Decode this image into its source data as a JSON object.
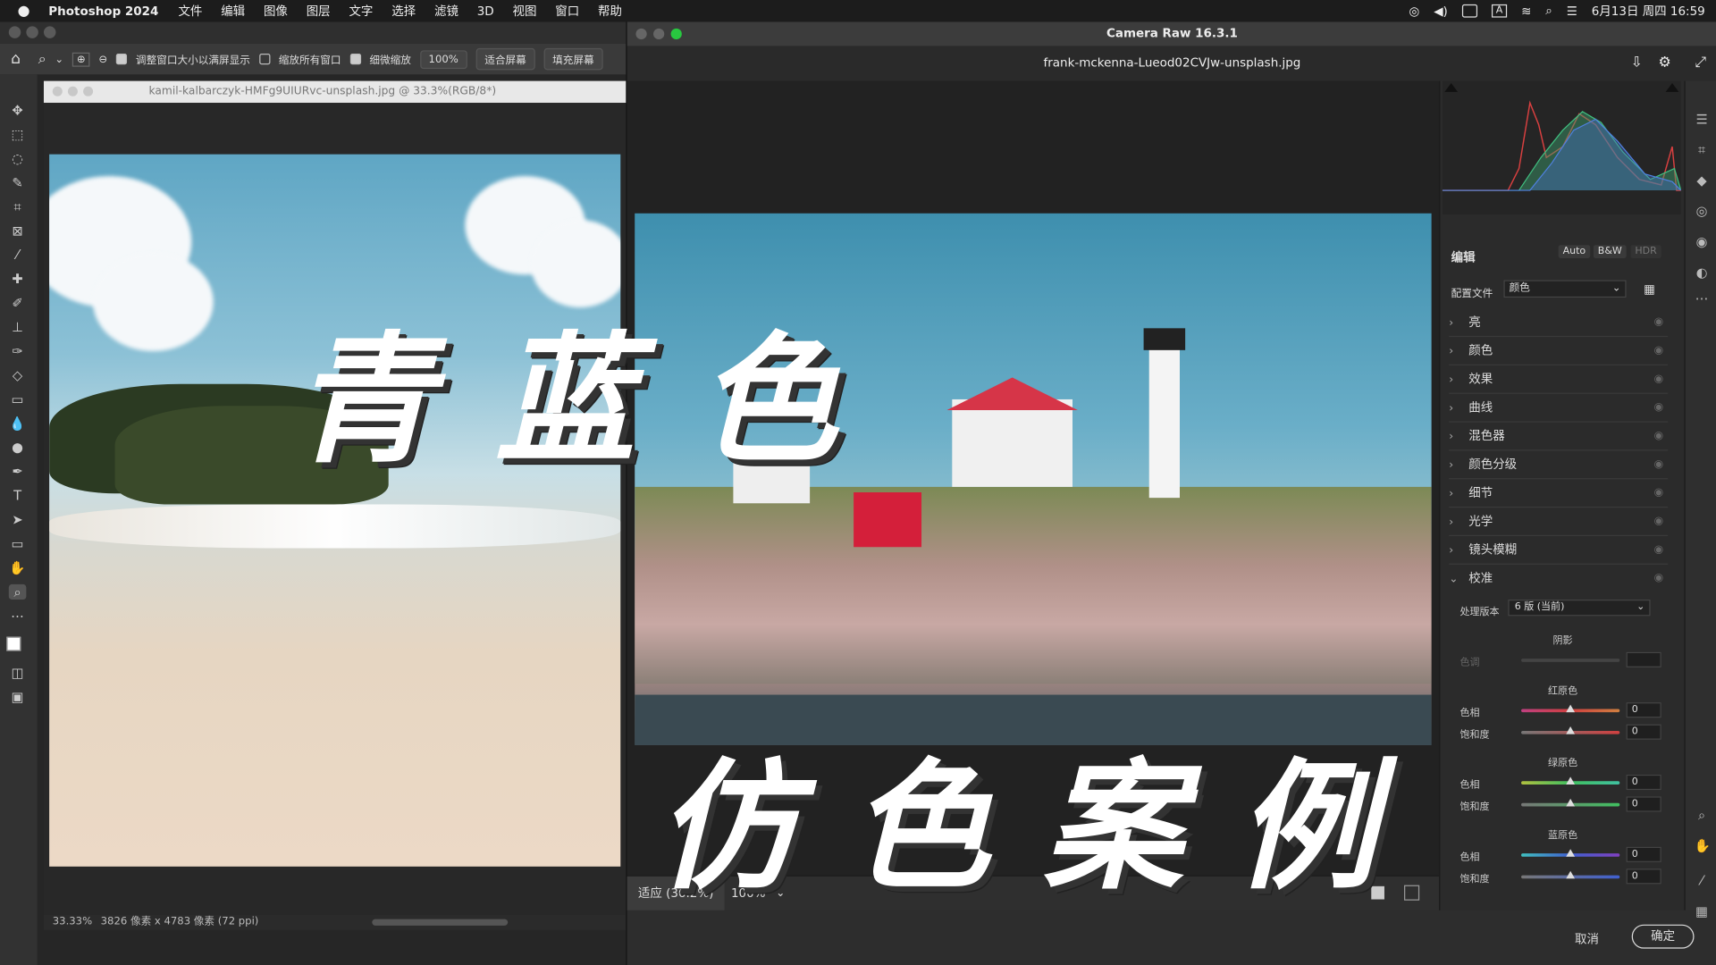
{
  "menubar": {
    "app": "Photoshop 2024",
    "items": [
      "文件",
      "编辑",
      "图像",
      "图层",
      "文字",
      "选择",
      "滤镜",
      "3D",
      "视图",
      "窗口",
      "帮助"
    ],
    "input_badge": "A",
    "datetime": "6月13日 周四  16:59"
  },
  "options_bar": {
    "resize_windows": "调整窗口大小以满屏显示",
    "zoom_all": "缩放所有窗口",
    "scrubby_zoom": "细微缩放",
    "zoom_value": "100%",
    "fit_screen": "适合屏幕",
    "fill_screen": "填充屏幕"
  },
  "document": {
    "title": "kamil-kalbarczyk-HMFg9UIURvc-unsplash.jpg @ 33.3%(RGB/8*)",
    "zoom": "33.33%",
    "info": "3826 像素 x 4783 像素 (72 ppi)"
  },
  "overlay": {
    "top_text": "青 蓝 色",
    "bottom_text": "仿 色 案 例"
  },
  "camera_raw": {
    "title": "Camera Raw 16.3.1",
    "filename": "frank-mckenna-Lueod02CVJw-unsplash.jpg",
    "fit_zoom": "适应 (36.2%)",
    "zoom_100": "100%",
    "cancel": "取消",
    "ok": "确定",
    "edit_label": "编辑",
    "auto": "Auto",
    "bw": "B&W",
    "hdr": "HDR",
    "profile_label": "配置文件",
    "profile_value": "颜色",
    "sections": [
      "亮",
      "颜色",
      "效果",
      "曲线",
      "混色器",
      "颜色分级",
      "细节",
      "光学",
      "镜头模糊"
    ],
    "calibration": {
      "title": "校准",
      "process_label": "处理版本",
      "process_value": "6 版 (当前)",
      "shadows": "阴影",
      "tint_label": "色调",
      "red_primary": "红原色",
      "green_primary": "绿原色",
      "blue_primary": "蓝原色",
      "hue_label": "色相",
      "sat_label": "饱和度",
      "values": {
        "red_hue": "0",
        "red_sat": "0",
        "green_hue": "0",
        "green_sat": "0",
        "blue_hue": "0",
        "blue_sat": "0"
      }
    }
  }
}
